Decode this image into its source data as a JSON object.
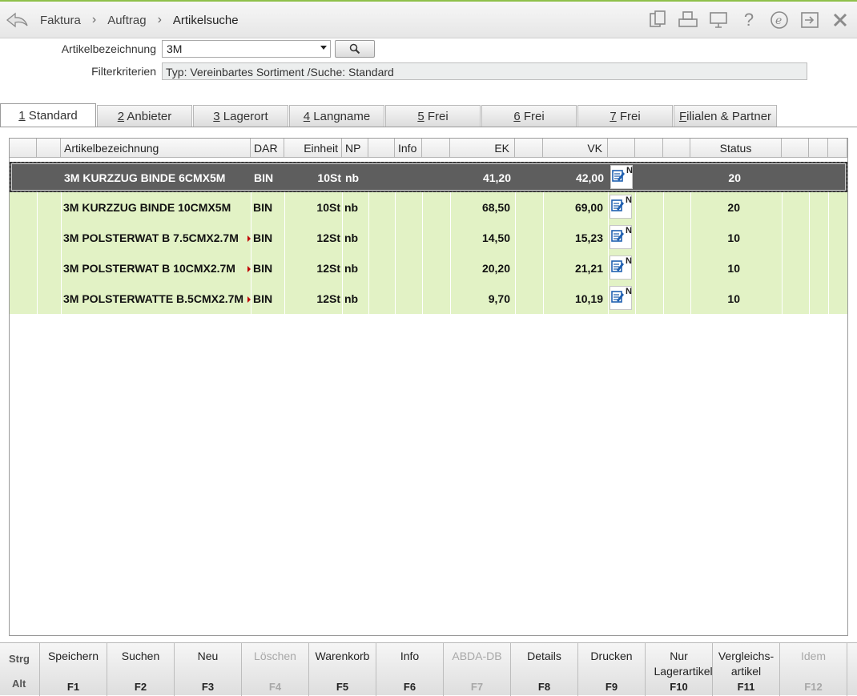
{
  "header": {
    "breadcrumbs": [
      "Faktura",
      "Auftrag",
      "Artikelsuche"
    ],
    "separator": "›",
    "icons": [
      "copy-icon",
      "print-icon",
      "monitor-icon",
      "help-icon",
      "e-icon",
      "export-icon",
      "close-icon"
    ]
  },
  "search": {
    "label": "Artikelbezeichnung",
    "value": "3M",
    "filter_label": "Filterkriterien",
    "filter_value": "Typ: Vereinbartes Sortiment /Suche: Standard"
  },
  "tabs": [
    {
      "key": "1",
      "label": " Standard"
    },
    {
      "key": "2",
      "label": " Anbieter"
    },
    {
      "key": "3",
      "label": " Lagerort"
    },
    {
      "key": "4",
      "label": " Langname"
    },
    {
      "key": "5",
      "label": " Frei"
    },
    {
      "key": "6",
      "label": " Frei"
    },
    {
      "key": "7",
      "label": " Frei"
    },
    {
      "key": "F",
      "label": "ilialen & Partner"
    }
  ],
  "table": {
    "headers": {
      "name": "Artikelbezeichnung",
      "dar": "DAR",
      "einheit": "Einheit",
      "np": "NP",
      "info": "Info",
      "ek": "EK",
      "vk": "VK",
      "status": "Status"
    },
    "rows": [
      {
        "name": "3M KURZZUG BINDE 6CMX5M",
        "dar": "BIN",
        "einheit": "10St",
        "np": "nb",
        "ek": "41,20",
        "vk": "42,00",
        "note": "N",
        "status": "20"
      },
      {
        "name": "3M KURZZUG BINDE 10CMX5M",
        "dar": "BIN",
        "einheit": "10St",
        "np": "nb",
        "ek": "68,50",
        "vk": "69,00",
        "note": "N",
        "status": "20"
      },
      {
        "name": "3M POLSTERWAT B 7.5CMX2.7M",
        "dar": "BIN",
        "einheit": "12St",
        "np": "nb",
        "ek": "14,50",
        "vk": "15,23",
        "note": "N",
        "status": "10"
      },
      {
        "name": "3M POLSTERWAT B 10CMX2.7M",
        "dar": "BIN",
        "einheit": "12St",
        "np": "nb",
        "ek": "20,20",
        "vk": "21,21",
        "note": "N",
        "status": "10"
      },
      {
        "name": "3M POLSTERWATTE B.5CMX2.7M",
        "dar": "BIN",
        "einheit": "12St",
        "np": "nb",
        "ek": "9,70",
        "vk": "10,19",
        "note": "N",
        "status": "10"
      }
    ]
  },
  "fbar": {
    "mod1": "Strg",
    "mod2": "Alt",
    "keys": [
      {
        "label": "Speichern",
        "key": "F1"
      },
      {
        "label": "Suchen",
        "key": "F2"
      },
      {
        "label": "Neu",
        "key": "F3"
      },
      {
        "label": "Löschen",
        "key": "F4"
      },
      {
        "label": "Warenkorb",
        "key": "F5"
      },
      {
        "label": "Info",
        "key": "F6"
      },
      {
        "label": "ABDA-DB",
        "key": "F7"
      },
      {
        "label": "Details",
        "key": "F8"
      },
      {
        "label": "Drucken",
        "key": "F9"
      },
      {
        "label": "Nur Lagerartikel",
        "key": "F10"
      },
      {
        "label": "Vergleichs-artikel",
        "key": "F11"
      },
      {
        "label": "Idem",
        "key": "F12"
      }
    ]
  },
  "colors": {
    "accent": "#8fc04a",
    "row_selected": "#5e5e5e",
    "row_green": "#e2f2c5"
  }
}
